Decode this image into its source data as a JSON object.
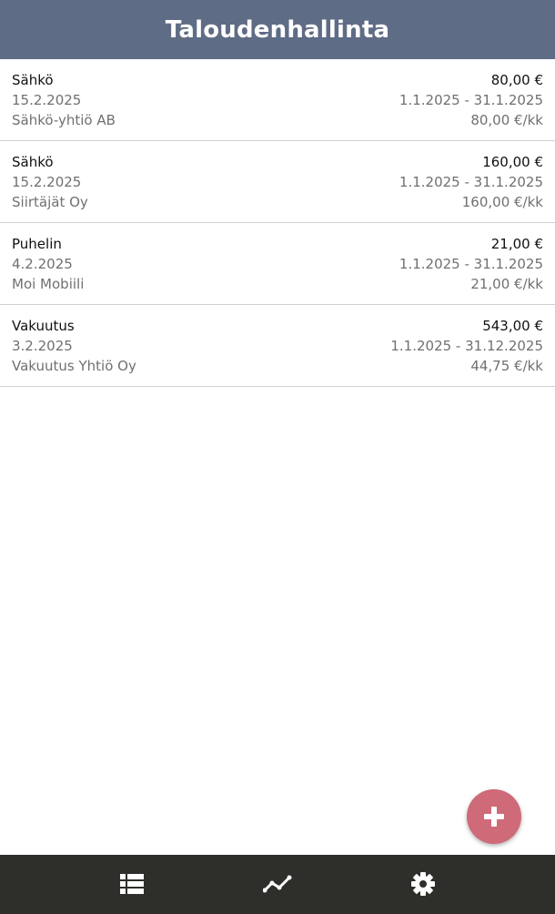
{
  "header": {
    "title": "Taloudenhallinta"
  },
  "bills": [
    {
      "name": "Sähkö",
      "amount": "80,00 €",
      "due_date": "15.2.2025",
      "period": "1.1.2025 - 31.1.2025",
      "company": "Sähkö-yhtiö AB",
      "monthly": "80,00 €/kk"
    },
    {
      "name": "Sähkö",
      "amount": "160,00 €",
      "due_date": "15.2.2025",
      "period": "1.1.2025 - 31.1.2025",
      "company": "Siirtäjät Oy",
      "monthly": "160,00 €/kk"
    },
    {
      "name": "Puhelin",
      "amount": "21,00 €",
      "due_date": "4.2.2025",
      "period": "1.1.2025 - 31.1.2025",
      "company": "Moi Mobiili",
      "monthly": "21,00 €/kk"
    },
    {
      "name": "Vakuutus",
      "amount": "543,00 €",
      "due_date": "3.2.2025",
      "period": "1.1.2025 - 31.12.2025",
      "company": "Vakuutus Yhtiö Oy",
      "monthly": "44,75 €/kk"
    }
  ],
  "fab": {
    "icon": "plus-icon"
  },
  "bottom_nav": {
    "items": [
      {
        "icon": "list-icon"
      },
      {
        "icon": "chart-line-icon"
      },
      {
        "icon": "gear-icon"
      }
    ]
  },
  "colors": {
    "header_bg": "#5f6c85",
    "fab_bg": "#cf6a78",
    "nav_bg": "#2e2e2a",
    "nav_icon": "#ffffff"
  }
}
